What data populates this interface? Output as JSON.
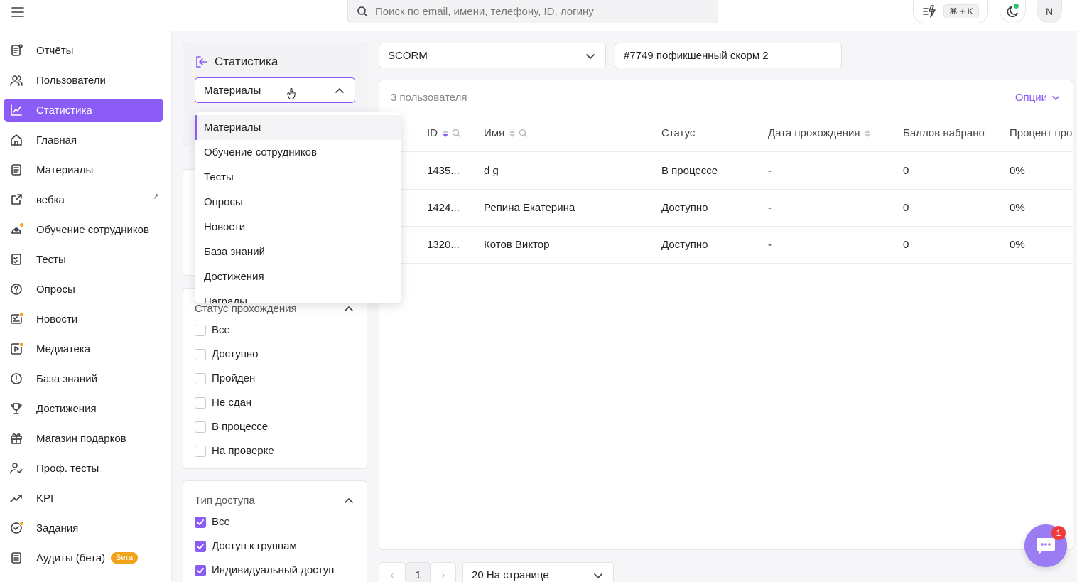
{
  "header": {
    "search_placeholder": "Поиск по email, имени, телефону, ID, логину",
    "shortcut": "⌘ + K",
    "avatar_initial": "N"
  },
  "sidebar": {
    "items": [
      {
        "label": "Отчёты",
        "icon": "report-icon"
      },
      {
        "label": "Пользователи",
        "icon": "users-icon"
      },
      {
        "label": "Статистика",
        "icon": "chart-line-icon",
        "active": true
      },
      {
        "label": "Главная",
        "icon": "home-icon"
      },
      {
        "label": "Материалы",
        "icon": "document-icon"
      },
      {
        "label": "вебка",
        "icon": "external-link-icon",
        "external": true
      },
      {
        "label": "Обучение сотрудников",
        "icon": "graduation-icon",
        "dot": true
      },
      {
        "label": "Тесты",
        "icon": "checklist-icon"
      },
      {
        "label": "Опросы",
        "icon": "question-bubble-icon"
      },
      {
        "label": "Новости",
        "icon": "news-icon",
        "dot": true
      },
      {
        "label": "Медиатека",
        "icon": "media-icon",
        "dot": true
      },
      {
        "label": "База знаний",
        "icon": "info-circle-icon"
      },
      {
        "label": "Достижения",
        "icon": "trophy-icon"
      },
      {
        "label": "Магазин подарков",
        "icon": "gift-icon"
      },
      {
        "label": "Проф. тесты",
        "icon": "person-check-icon"
      },
      {
        "label": "KPI",
        "icon": "trend-up-icon"
      },
      {
        "label": "Задания",
        "icon": "task-check-icon",
        "dot": true
      },
      {
        "label": "Аудиты (бета)",
        "icon": "audit-icon",
        "badge": "Бета"
      }
    ]
  },
  "stats_panel": {
    "title": "Статистика",
    "selected": "Материалы",
    "dropdown_options": [
      "Материалы",
      "Обучение сотрудников",
      "Тесты",
      "Опросы",
      "Новости",
      "База знаний",
      "Достижения",
      "Награды"
    ]
  },
  "status_filter": {
    "title": "Статус прохождения",
    "options": [
      {
        "label": "Все",
        "checked": false
      },
      {
        "label": "Доступно",
        "checked": false
      },
      {
        "label": "Пройден",
        "checked": false
      },
      {
        "label": "Не сдан",
        "checked": false
      },
      {
        "label": "В процессе",
        "checked": false
      },
      {
        "label": "На проверке",
        "checked": false
      }
    ]
  },
  "access_filter": {
    "title": "Тип доступа",
    "options": [
      {
        "label": "Все",
        "checked": true
      },
      {
        "label": "Доступ к группам",
        "checked": true
      },
      {
        "label": "Индивидуальный доступ",
        "checked": true
      }
    ]
  },
  "type_select": {
    "value": "SCORM"
  },
  "material_select": {
    "value": "#7749 пофикшенный скорм 2"
  },
  "table": {
    "count": "3 пользователя",
    "options_label": "Опции",
    "headers": [
      "ID",
      "Имя",
      "Статус",
      "Дата прохождения",
      "Баллов набрано",
      "Процент про..."
    ],
    "rows": [
      [
        "1435...",
        "d g",
        "В процессе",
        "-",
        "0",
        "0%"
      ],
      [
        "1424...",
        "Репина Екатерина",
        "Доступно",
        "-",
        "0",
        "0%"
      ],
      [
        "1320...",
        "Котов Виктор",
        "Доступно",
        "-",
        "0",
        "0%"
      ]
    ]
  },
  "pagination": {
    "prev": "‹",
    "page": "1",
    "next": "›",
    "per_page": "20 На странице"
  },
  "chat": {
    "badge": "1"
  },
  "colors": {
    "accent": "#8b5cf6",
    "dot": "#f2a31a",
    "online": "#2fc26b",
    "badge": "#ef3b3b"
  }
}
